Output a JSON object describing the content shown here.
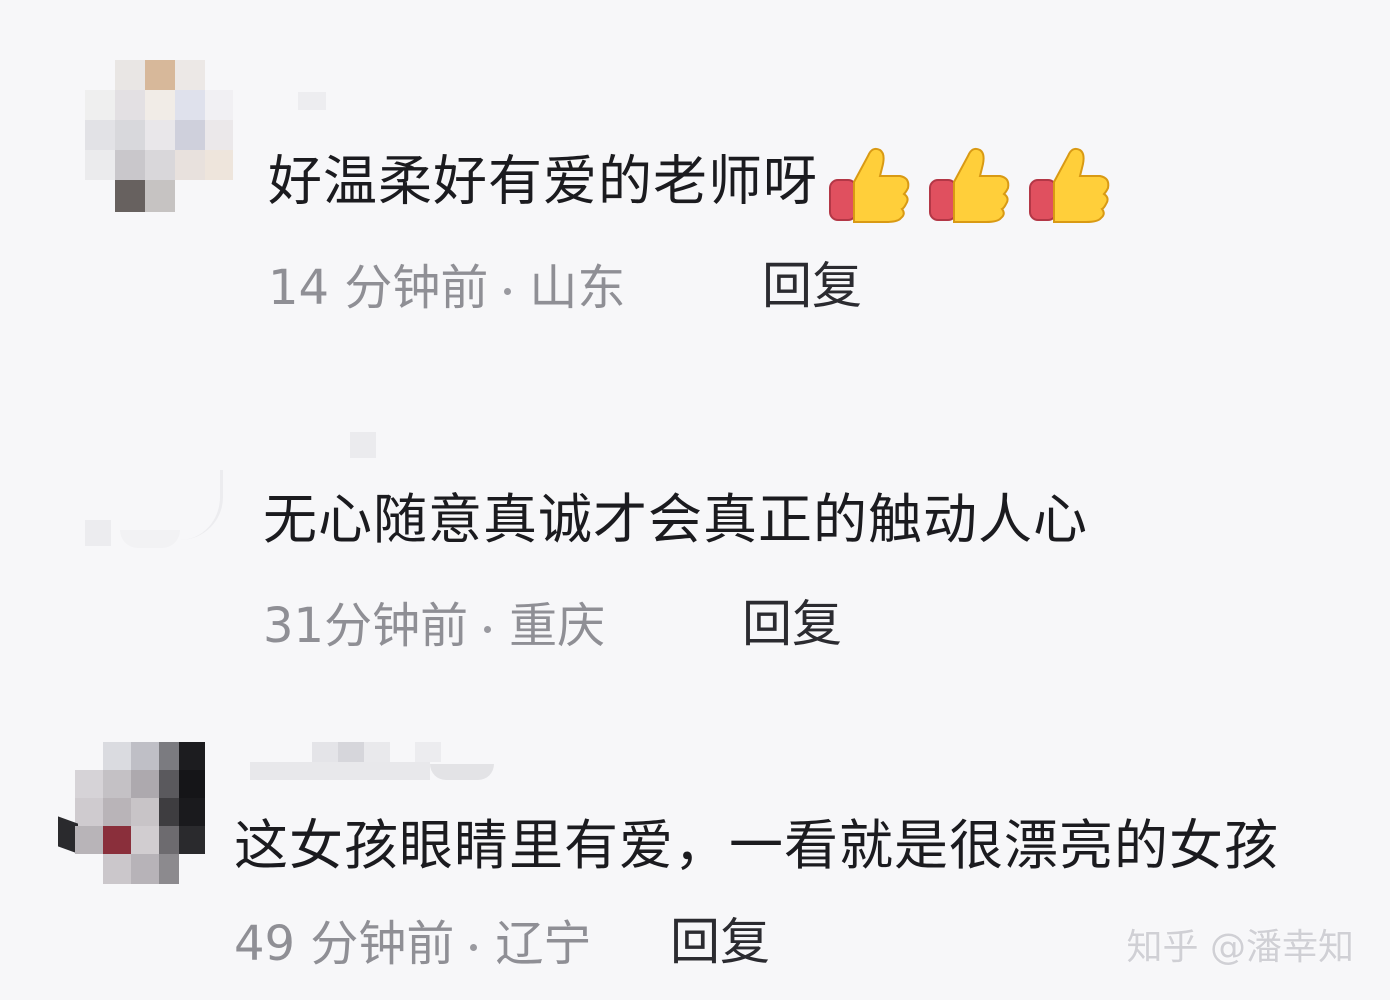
{
  "comments": [
    {
      "text": "好温柔好有爱的老师呀",
      "emoji": "thumbs-up-icon",
      "emoji_count": 3,
      "time": "14 分钟前",
      "location": "山东",
      "reply_label": "回复"
    },
    {
      "text": "无心随意真诚才会真正的触动人心",
      "time": "31分钟前",
      "location": "重庆",
      "reply_label": "回复"
    },
    {
      "text": "这女孩眼睛里有爱，一看就是很漂亮的女孩",
      "time": "49 分钟前",
      "location": "辽宁",
      "reply_label": "回复"
    }
  ],
  "watermark": "知乎 @潘幸知",
  "colors": {
    "background": "#f7f7f9",
    "text": "#1b1b1f",
    "meta": "#8f8f95",
    "reply": "#2b2b30"
  }
}
